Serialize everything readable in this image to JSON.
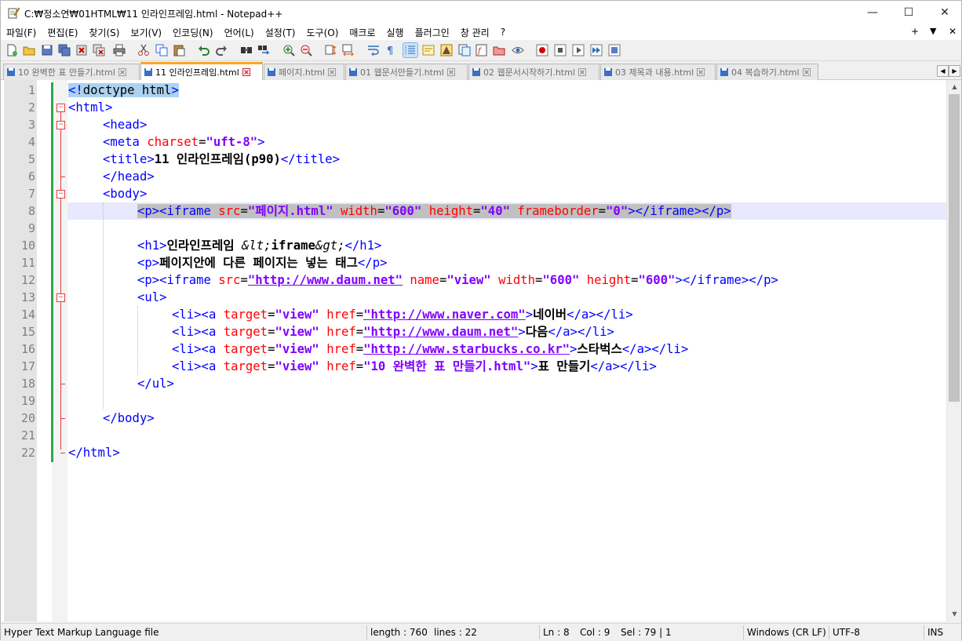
{
  "window": {
    "title": "C:₩정소연₩01HTML₩11 인라인프레임.html - Notepad++",
    "minimize_glyph": "—",
    "maximize_glyph": "☐",
    "close_glyph": "✕"
  },
  "menu": {
    "items": [
      "파일(F)",
      "편집(E)",
      "찾기(S)",
      "보기(V)",
      "인코딩(N)",
      "언어(L)",
      "설정(T)",
      "도구(O)",
      "매크로",
      "실행",
      "플러그인",
      "창 관리",
      "?"
    ],
    "right_plus": "+",
    "right_arrow": "▼",
    "right_close": "✕"
  },
  "tabs": [
    {
      "label": "10 완벽한 표 만들기.html",
      "active": false
    },
    {
      "label": "11 인라인프레임.html",
      "active": true
    },
    {
      "label": "페이지.html",
      "active": false
    },
    {
      "label": "01 웹문서만들기.html",
      "active": false
    },
    {
      "label": "02 웹문서시작하기.html",
      "active": false
    },
    {
      "label": "03 제목과 내용.html",
      "active": false
    },
    {
      "label": "04 복습하기.html",
      "active": false
    }
  ],
  "editor": {
    "line_numbers": [
      "1",
      "2",
      "3",
      "4",
      "5",
      "6",
      "7",
      "8",
      "9",
      "10",
      "11",
      "12",
      "13",
      "14",
      "15",
      "16",
      "17",
      "18",
      "19",
      "20",
      "21",
      "22"
    ],
    "code": {
      "l1_a": "<!",
      "l1_b": "doctype html",
      "l1_c": ">",
      "l2": "<html>",
      "l3": "<head>",
      "l4_tag": "<meta ",
      "l4_attr": "charset",
      "l4_eq": "=",
      "l4_val": "\"uft-8\"",
      "l4_end": ">",
      "l5_open": "<title>",
      "l5_text": "11 인라인프레임(p90)",
      "l5_close": "</title>",
      "l6": "</head>",
      "l7": "<body>",
      "l8_1": "<p><iframe ",
      "l8_2": "src",
      "l8_3": "=",
      "l8_4": "\"페이지.html\"",
      "l8_5": " ",
      "l8_6": "width",
      "l8_7": "=",
      "l8_8": "\"600\"",
      "l8_9": " ",
      "l8_10": "height",
      "l8_11": "=",
      "l8_12": "\"40\"",
      "l8_13": " ",
      "l8_14": "frameborder",
      "l8_15": "=",
      "l8_16": "\"0\"",
      "l8_17": "></iframe></p>",
      "l10_open": "<h1>",
      "l10_text": "인라인프레임 ",
      "l10_lt": "&lt;",
      "l10_iframe": "iframe",
      "l10_gt": "&gt;",
      "l10_close": "</h1>",
      "l11_open": "<p>",
      "l11_text": "페이지안에 다른 페이지는 넣는 태그",
      "l11_close": "</p>",
      "l12_1": "<p><iframe ",
      "l12_2": "src",
      "l12_3": "=",
      "l12_4": "\"http://www.daum.net\"",
      "l12_5": " ",
      "l12_6": "name",
      "l12_7": "=",
      "l12_8": "\"view\"",
      "l12_9": " ",
      "l12_10": "width",
      "l12_11": "=",
      "l12_12": "\"600\"",
      "l12_13": " ",
      "l12_14": "height",
      "l12_15": "=",
      "l12_16": "\"600\"",
      "l12_17": "></iframe></p>",
      "l13": "<ul>",
      "li_open": "<li><a ",
      "li_target": "target",
      "li_eq": "=",
      "li_view": "\"view\"",
      "li_href": "href",
      "l14_url": "\"http://www.naver.com\"",
      "l14_gt": ">",
      "l14_text": "네이버",
      "l14_close": "</a></li>",
      "l15_url": "\"http://www.daum.net\"",
      "l15_gt": ">",
      "l15_text": "다음",
      "l15_close": "</a></li>",
      "l16_url": "\"http://www.starbucks.co.kr\"",
      "l16_gt": ">",
      "l16_text": "스타벅스",
      "l16_close": "</a></li>",
      "l17_url": "\"10 완벽한 표 만들기.html\"",
      "l17_gt": ">",
      "l17_text": "표 만들기",
      "l17_close": "</a></li>",
      "l18": "</ul>",
      "l20": "</body>",
      "l22": "</html>"
    }
  },
  "status": {
    "filetype": "Hyper Text Markup Language file",
    "length": "length : 760",
    "lines": "lines : 22",
    "ln": "Ln : 8",
    "col": "Col : 9",
    "sel": "Sel : 79 | 1",
    "eol": "Windows (CR LF)",
    "encoding": "UTF-8",
    "mode": "INS"
  },
  "colors": {
    "tag": "#0000ff",
    "attribute": "#ff0000",
    "value": "#8000ff",
    "active_tab_accent": "#f9a825",
    "change_bar": "#2ea84e"
  }
}
